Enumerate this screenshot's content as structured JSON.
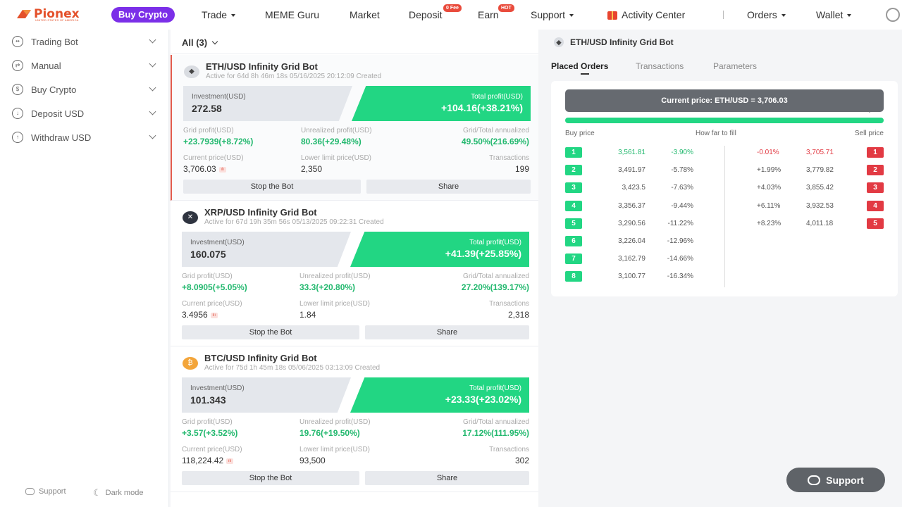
{
  "brand": {
    "name": "Pionex",
    "sub": "UNITED STATES OF AMERICA",
    "color": "#e4512b"
  },
  "topbar": {
    "buy_crypto": "Buy Crypto",
    "trade": "Trade",
    "meme": "MEME Guru",
    "market": "Market",
    "deposit": "Deposit",
    "deposit_badge": "0 Fee",
    "earn": "Earn",
    "earn_badge": "HOT",
    "support": "Support",
    "activity": "Activity Center",
    "orders": "Orders",
    "wallet": "Wallet"
  },
  "sidebar": {
    "items": [
      {
        "label": "Trading Bot"
      },
      {
        "label": "Manual"
      },
      {
        "label": "Buy Crypto"
      },
      {
        "label": "Deposit USD"
      },
      {
        "label": "Withdraw USD"
      }
    ],
    "footer_support": "Support",
    "footer_dark": "Dark mode"
  },
  "list": {
    "filter": "All (3)",
    "labels": {
      "investment": "Investment(USD)",
      "total_profit": "Total profit(USD)",
      "grid_profit": "Grid profit(USD)",
      "unrealized": "Unrealized profit(USD)",
      "annualized": "Grid/Total annualized",
      "current_price": "Current price(USD)",
      "lower_limit": "Lower limit price(USD)",
      "transactions": "Transactions",
      "stop": "Stop the Bot",
      "share": "Share"
    },
    "bots": [
      {
        "title": "ETH/USD Infinity Grid Bot",
        "sub": "Active for 64d 8h 46m 18s 05/16/2025 20:12:09 Created",
        "investment": "272.58",
        "total_profit": "+104.16(+38.21%)",
        "grid_profit": "+23.7939(+8.72%)",
        "unrealized": "80.36(+29.48%)",
        "annualized": "49.50%(216.69%)",
        "current_price": "3,706.03",
        "lower_limit": "2,350",
        "transactions": "199",
        "coin": "ETH"
      },
      {
        "title": "XRP/USD Infinity Grid Bot",
        "sub": "Active for 67d 19h 35m 56s 05/13/2025 09:22:31 Created",
        "investment": "160.075",
        "total_profit": "+41.39(+25.85%)",
        "grid_profit": "+8.0905(+5.05%)",
        "unrealized": "33.3(+20.80%)",
        "annualized": "27.20%(139.17%)",
        "current_price": "3.4956",
        "lower_limit": "1.84",
        "transactions": "2,318",
        "coin": "XRP"
      },
      {
        "title": "BTC/USD Infinity Grid Bot",
        "sub": "Active for 75d 1h 45m 18s 05/06/2025 03:13:09 Created",
        "investment": "101.343",
        "total_profit": "+23.33(+23.02%)",
        "grid_profit": "+3.57(+3.52%)",
        "unrealized": "19.76(+19.50%)",
        "annualized": "17.12%(111.95%)",
        "current_price": "118,224.42",
        "lower_limit": "93,500",
        "transactions": "302",
        "coin": "BTC"
      }
    ]
  },
  "panel": {
    "title": "ETH/USD Infinity Grid Bot",
    "tabs": [
      "Placed Orders",
      "Transactions",
      "Parameters"
    ],
    "current_price": "Current price: ETH/USD = 3,706.03",
    "headers": {
      "buy": "Buy price",
      "far": "How far to fill",
      "sell": "Sell price"
    },
    "buy_orders": [
      {
        "n": "1",
        "price": "3,561.81",
        "pct": "-3.90%"
      },
      {
        "n": "2",
        "price": "3,491.97",
        "pct": "-5.78%"
      },
      {
        "n": "3",
        "price": "3,423.5",
        "pct": "-7.63%"
      },
      {
        "n": "4",
        "price": "3,356.37",
        "pct": "-9.44%"
      },
      {
        "n": "5",
        "price": "3,290.56",
        "pct": "-11.22%"
      },
      {
        "n": "6",
        "price": "3,226.04",
        "pct": "-12.96%"
      },
      {
        "n": "7",
        "price": "3,162.79",
        "pct": "-14.66%"
      },
      {
        "n": "8",
        "price": "3,100.77",
        "pct": "-16.34%"
      }
    ],
    "sell_orders": [
      {
        "n": "1",
        "price": "3,705.71",
        "pct": "-0.01%"
      },
      {
        "n": "2",
        "price": "3,779.82",
        "pct": "+1.99%"
      },
      {
        "n": "3",
        "price": "3,855.42",
        "pct": "+4.03%"
      },
      {
        "n": "4",
        "price": "3,932.53",
        "pct": "+6.11%"
      },
      {
        "n": "5",
        "price": "4,011.18",
        "pct": "+8.23%"
      }
    ]
  },
  "support_fab": "Support"
}
